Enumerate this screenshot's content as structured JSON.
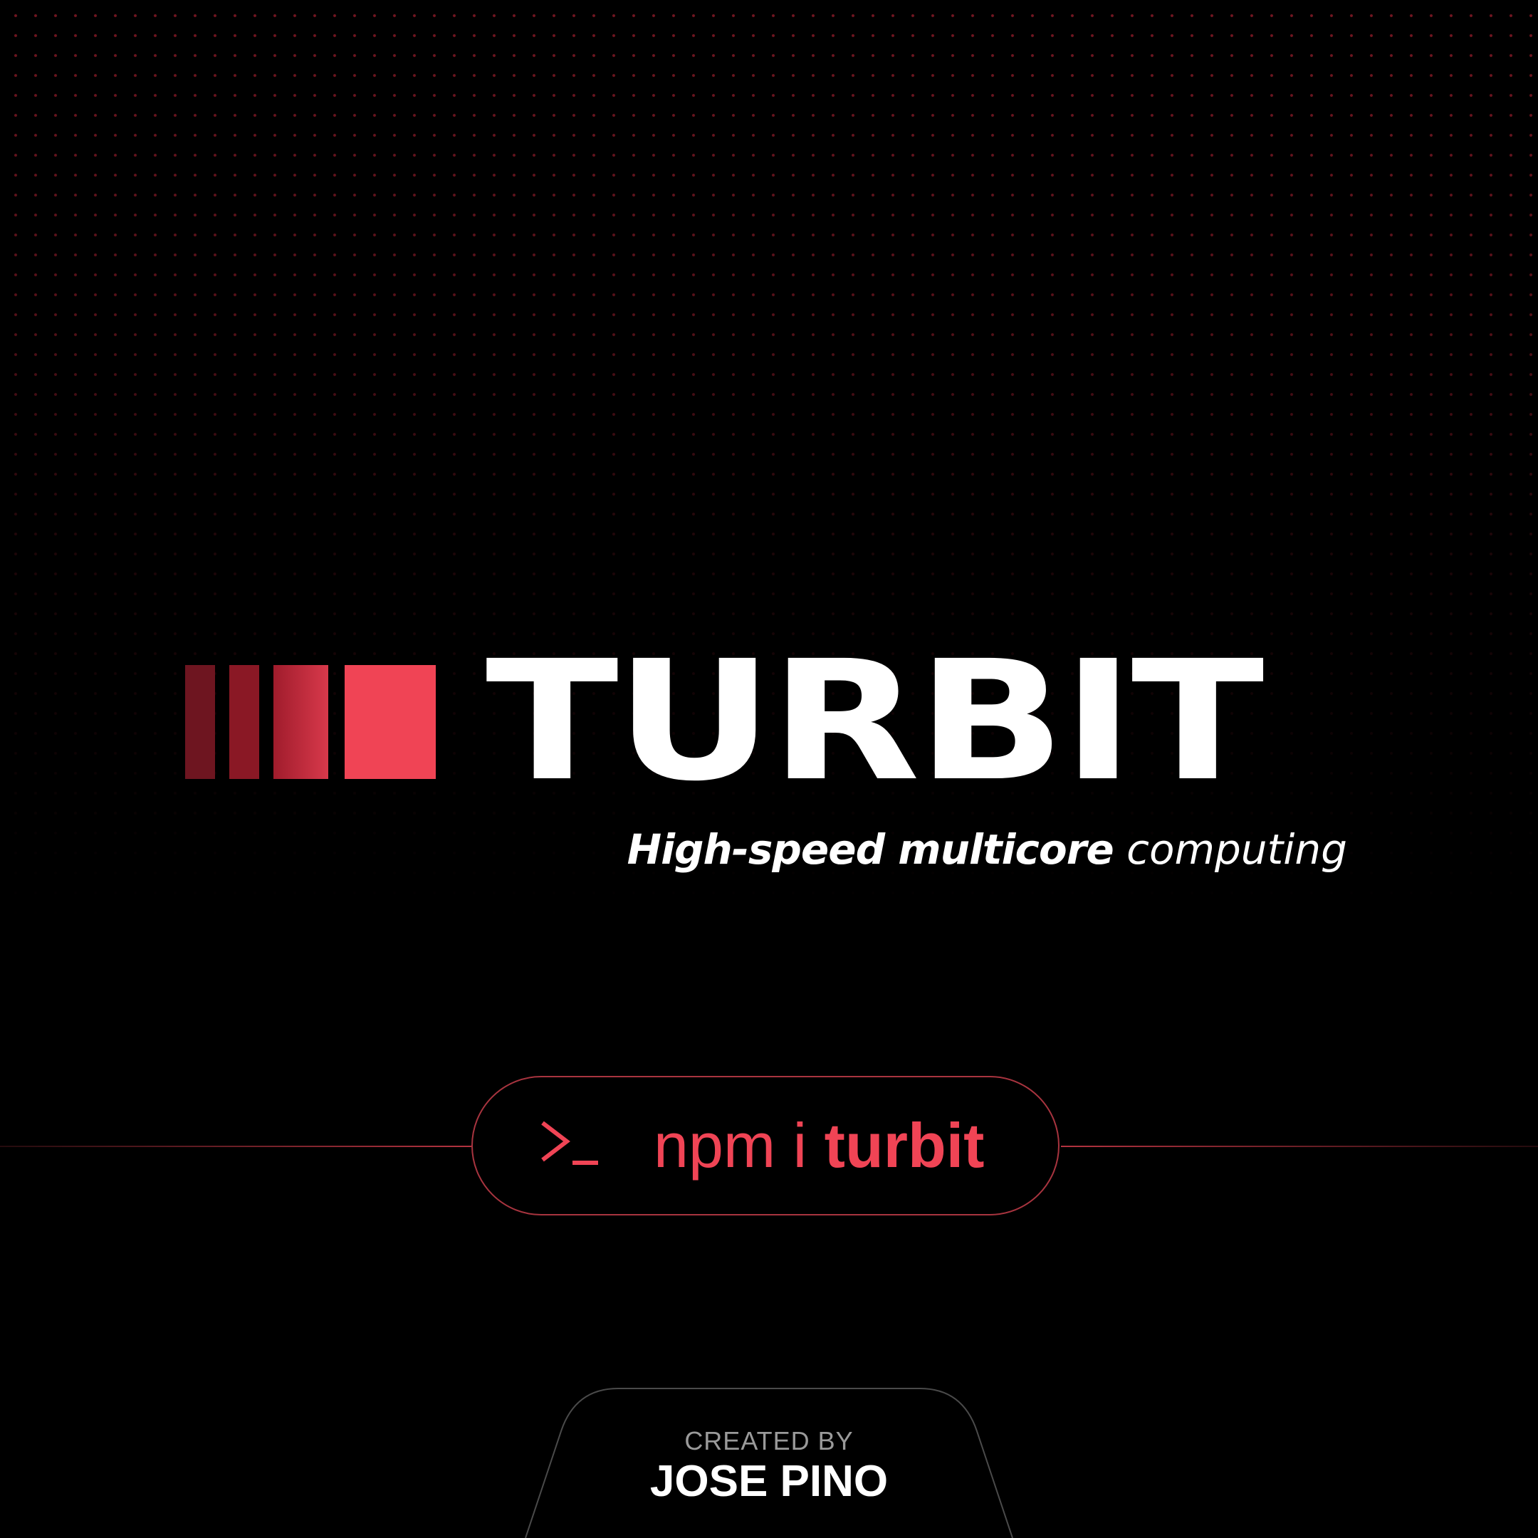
{
  "brand": {
    "name": "TURBIT",
    "tagline_strong": "High-speed multicore",
    "tagline_light": "computing",
    "logo_icon": "speed-bars-icon"
  },
  "install": {
    "icon": "terminal-prompt-icon",
    "command": "npm i",
    "package": "turbit"
  },
  "credit": {
    "label": "CREATED BY",
    "name": "JOSE PINO"
  },
  "colors": {
    "background": "#000000",
    "accent": "#f04455",
    "accent_dark": "#6e1520",
    "text": "#ffffff",
    "muted": "#9a9a9a"
  }
}
